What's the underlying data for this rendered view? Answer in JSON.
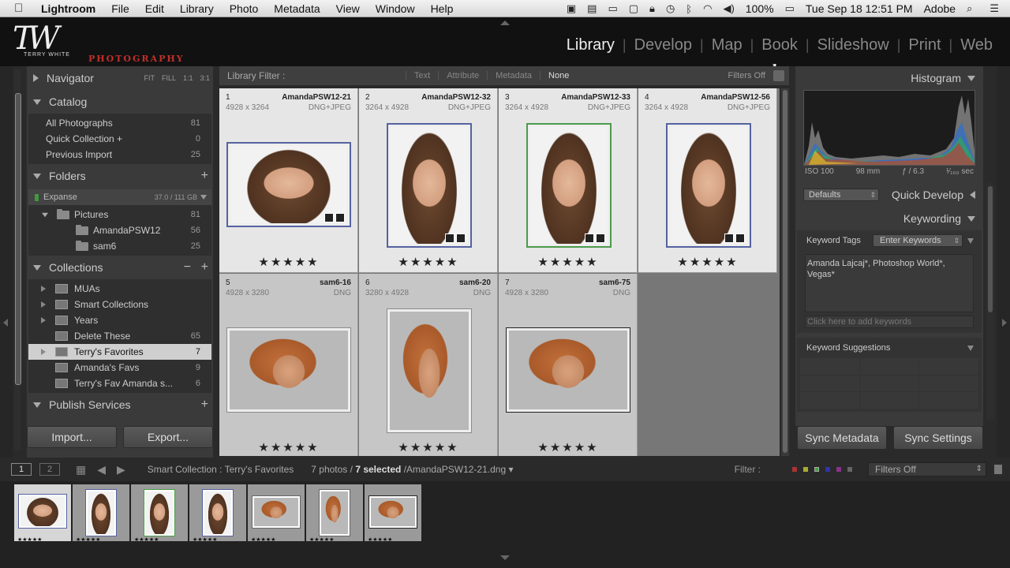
{
  "menubar": {
    "app_name": "Lightroom",
    "items": [
      "File",
      "Edit",
      "Library",
      "Photo",
      "Metadata",
      "View",
      "Window",
      "Help"
    ],
    "battery": "100%",
    "datetime": "Tue Sep 18  12:51 PM",
    "user": "Adobe"
  },
  "identity": {
    "monogram": "TW",
    "small_name": "TERRY WHITE",
    "photo_word": "PHOTOGRAPHY"
  },
  "modules": [
    "Library",
    "Develop",
    "Map",
    "Book",
    "Slideshow",
    "Print",
    "Web"
  ],
  "active_module": "Library",
  "left": {
    "navigator": {
      "title": "Navigator",
      "opts": [
        "FIT",
        "FILL",
        "1:1",
        "3:1"
      ]
    },
    "catalog": {
      "title": "Catalog",
      "items": [
        {
          "label": "All Photographs",
          "count": "81"
        },
        {
          "label": "Quick Collection  +",
          "count": "0"
        },
        {
          "label": "Previous Import",
          "count": "25"
        }
      ]
    },
    "folders": {
      "title": "Folders",
      "drive": {
        "name": "Expanse",
        "size": "37.0 / 111 GB"
      },
      "items": [
        {
          "label": "Pictures",
          "count": "81"
        },
        {
          "label": "AmandaPSW12",
          "count": "56"
        },
        {
          "label": "sam6",
          "count": "25"
        }
      ]
    },
    "collections": {
      "title": "Collections",
      "items": [
        {
          "label": "MUAs",
          "count": ""
        },
        {
          "label": "Smart Collections",
          "count": ""
        },
        {
          "label": "Years",
          "count": ""
        },
        {
          "label": "Delete These",
          "count": "65"
        },
        {
          "label": "Terry's Favorites",
          "count": "7"
        },
        {
          "label": "Amanda's Favs",
          "count": "9"
        },
        {
          "label": "Terry's Fav Amanda s...",
          "count": "6"
        }
      ]
    },
    "publish": {
      "title": "Publish Services"
    },
    "import_label": "Import...",
    "export_label": "Export..."
  },
  "filter_bar": {
    "label": "Library Filter :",
    "options": [
      "Text",
      "Attribute",
      "Metadata",
      "None"
    ],
    "active": "None",
    "filters_off": "Filters Off"
  },
  "grid": {
    "cells": [
      {
        "index": "1",
        "name": "AmandaPSW12-21",
        "dims": "4928 x 3264",
        "type": "DNG+JPEG",
        "stars": "★★★★★"
      },
      {
        "index": "2",
        "name": "AmandaPSW12-32",
        "dims": "3264 x 4928",
        "type": "DNG+JPEG",
        "stars": "★★★★★"
      },
      {
        "index": "3",
        "name": "AmandaPSW12-33",
        "dims": "3264 x 4928",
        "type": "DNG+JPEG",
        "stars": "★★★★★"
      },
      {
        "index": "4",
        "name": "AmandaPSW12-56",
        "dims": "3264 x 4928",
        "type": "DNG+JPEG",
        "stars": "★★★★★"
      },
      {
        "index": "5",
        "name": "sam6-16",
        "dims": "4928 x 3280",
        "type": "DNG",
        "stars": "★★★★★"
      },
      {
        "index": "6",
        "name": "sam6-20",
        "dims": "3280 x 4928",
        "type": "DNG",
        "stars": "★★★★★"
      },
      {
        "index": "7",
        "name": "sam6-75",
        "dims": "4928 x 3280",
        "type": "DNG",
        "stars": "★★★★★"
      }
    ]
  },
  "right": {
    "histogram": {
      "title": "Histogram",
      "iso": "ISO 100",
      "focal": "98 mm",
      "aperture": "ƒ / 6.3",
      "shutter": "¹⁄₁₆₀ sec"
    },
    "quick_develop": {
      "title": "Quick Develop",
      "preset": "Defaults"
    },
    "keywording": {
      "title": "Keywording",
      "tags_label": "Keyword Tags",
      "tags_select": "Enter Keywords",
      "keywords": "Amanda Lajcaj*, Photoshop World*, Vegas*",
      "add_placeholder": "Click here to add keywords",
      "suggestions_label": "Keyword Suggestions"
    },
    "sync_metadata": "Sync Metadata",
    "sync_settings": "Sync Settings"
  },
  "filmbar": {
    "view1": "1",
    "view2": "2",
    "source": "Smart Collection : Terry's Favorites",
    "count_prefix": "7 photos /",
    "count_selected": "7 selected",
    "count_file": "/AmandaPSW12-21.dng ▾",
    "filter_label": "Filter :",
    "filter_value": "Filters Off"
  },
  "filmstrip": {
    "stars": [
      "★★★★★",
      "★★★★★",
      "★★★★★",
      "★★★★★",
      "★★★★★",
      "★★★★★",
      "★★★★★"
    ]
  },
  "colors": {
    "accent_selected_border": "#5563a0",
    "green_label": "#4c9a4c",
    "photography_red": "#c0302a"
  }
}
